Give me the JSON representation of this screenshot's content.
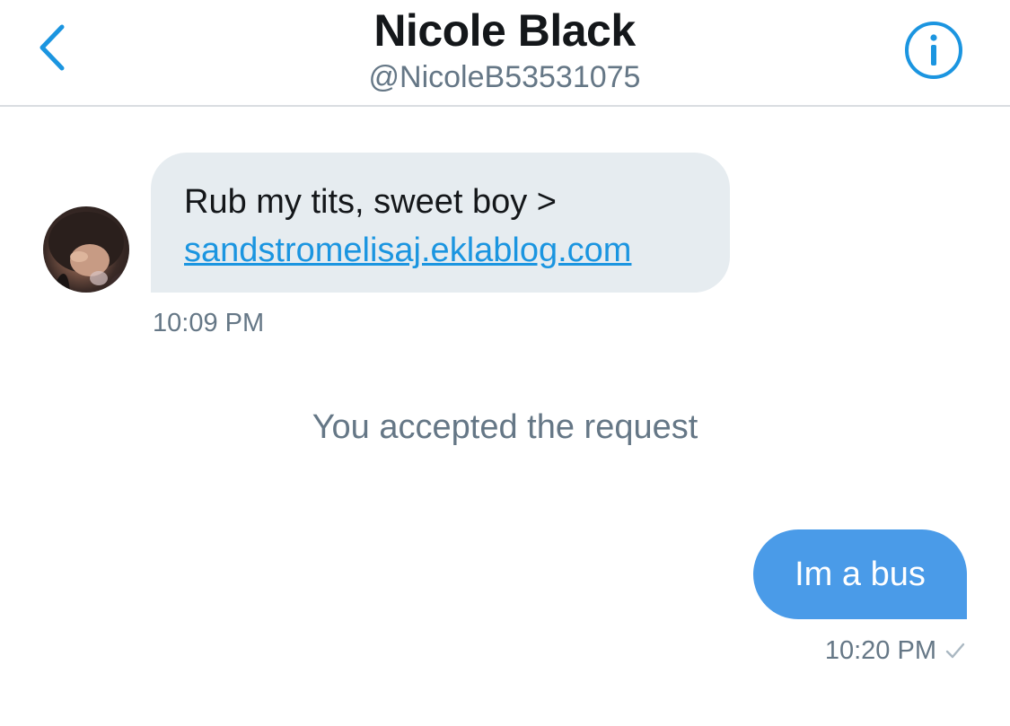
{
  "header": {
    "title": "Nicole Black",
    "handle": "@NicoleB53531075",
    "back_icon": "chevron-left-icon",
    "info_icon": "info-icon"
  },
  "messages": {
    "incoming": {
      "text": "Rub my tits, sweet boy >",
      "link": "sandstromelisaj.eklablog.com",
      "time": "10:09 PM"
    },
    "system_note": "You accepted the request",
    "outgoing": {
      "text": "Im a bus",
      "time": "10:20 PM",
      "status_icon": "checkmark-icon"
    }
  },
  "colors": {
    "accent": "#1b95e0",
    "outgoing_bubble": "#4a9be8",
    "incoming_bubble": "#e6ecf0",
    "muted_text": "#657786"
  }
}
